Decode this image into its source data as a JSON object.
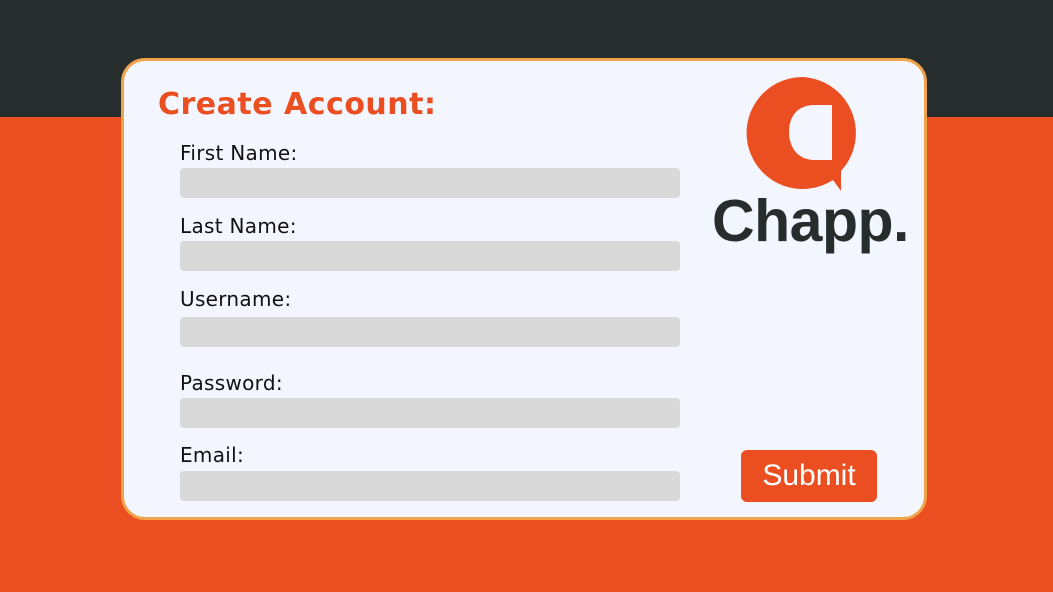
{
  "form": {
    "title": "Create Account:",
    "fields": [
      {
        "label": "First Name:",
        "value": ""
      },
      {
        "label": "Last Name:",
        "value": ""
      },
      {
        "label": "Username:",
        "value": ""
      },
      {
        "label": "Password:",
        "value": ""
      },
      {
        "label": "Email:",
        "value": ""
      }
    ],
    "submit_label": "Submit"
  },
  "brand": {
    "name": "Chapp.",
    "logo_icon": "chat-bubble-icon"
  },
  "colors": {
    "accent": "#eb4f21",
    "dark": "#272c2d",
    "card": "#f3f6fe",
    "card_border": "#f0a44a",
    "input_fill": "#d9d9d9"
  }
}
